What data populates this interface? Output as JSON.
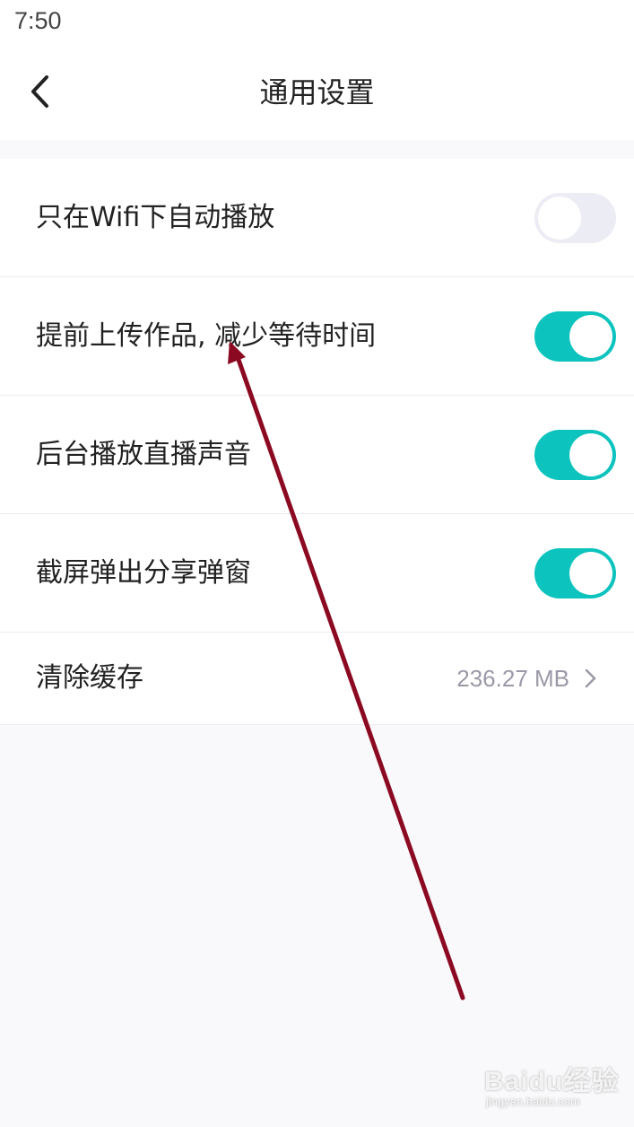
{
  "status_bar": {
    "time": "7:50"
  },
  "header": {
    "title": "通用设置",
    "back_icon": "chevron-left-icon"
  },
  "settings": [
    {
      "label": "只在Wifi下自动播放",
      "toggle_on": false
    },
    {
      "label": "提前上传作品, 减少等待时间",
      "toggle_on": true
    },
    {
      "label": "后台播放直播声音",
      "toggle_on": true
    },
    {
      "label": "截屏弹出分享弹窗",
      "toggle_on": true
    }
  ],
  "cache": {
    "label": "清除缓存",
    "size": "236.27 MB",
    "icon": "chevron-right-icon"
  },
  "annotation": {
    "color": "#8b0a22"
  },
  "watermark": {
    "brand": "Baidu经验",
    "url": "jingyan.baidu.com"
  },
  "colors": {
    "toggle_on": "#0cc3bd",
    "toggle_off": "#ececf4",
    "background": "#f9f8fa",
    "secondary_text": "#9a99a8"
  }
}
